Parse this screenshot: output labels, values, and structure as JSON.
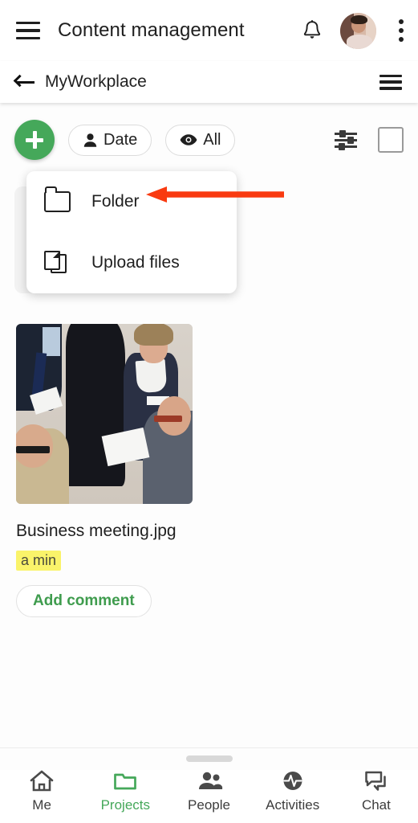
{
  "header": {
    "menu_icon": "hamburger-icon",
    "title": "Content management",
    "bell_icon": "notification-bell-icon",
    "avatar_icon": "user-avatar",
    "overflow_icon": "kebab-menu-icon"
  },
  "subheader": {
    "back_icon": "back-arrow-icon",
    "breadcrumb": "MyWorkplace",
    "menu_icon": "list-menu-icon"
  },
  "toolbar": {
    "add_label": "+",
    "add_icon": "plus-icon",
    "chips": [
      {
        "label": "Date",
        "icon": "person-icon"
      },
      {
        "label": "All",
        "icon": "eye-icon"
      }
    ],
    "tune_icon": "sliders-filter-icon",
    "select_all_icon": "checkbox-unchecked-icon"
  },
  "dropdown": {
    "items": [
      {
        "label": "Folder",
        "icon": "folder-icon"
      },
      {
        "label": "Upload files",
        "icon": "files-stack-icon"
      }
    ]
  },
  "annotation": {
    "arrow_icon": "red-pointer-arrow",
    "color": "#F93A10",
    "points_to": "Folder"
  },
  "file_card": {
    "thumbnail_icon": "business-meeting-photo",
    "name": "Business meeting.jpg",
    "time": "a min",
    "comment_label": "Add comment",
    "comment_color": "#3F9C4E",
    "time_highlight": "#FAF36A"
  },
  "bottom_nav": {
    "handle_icon": "drag-handle",
    "active_color": "#45A85A",
    "items": [
      {
        "label": "Me",
        "icon": "home-icon",
        "active": false
      },
      {
        "label": "Projects",
        "icon": "folder-icon",
        "active": true
      },
      {
        "label": "People",
        "icon": "people-icon",
        "active": false
      },
      {
        "label": "Activities",
        "icon": "activity-pulse-icon",
        "active": false
      },
      {
        "label": "Chat",
        "icon": "chat-bubbles-icon",
        "active": false
      }
    ]
  }
}
